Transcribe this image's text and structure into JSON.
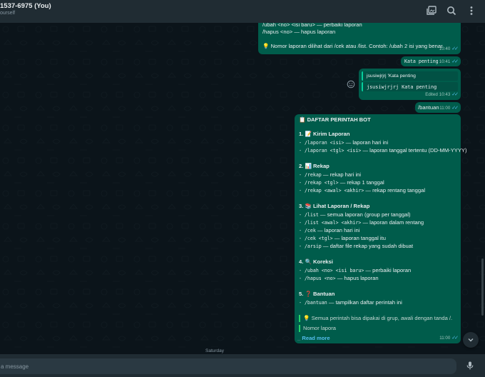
{
  "header": {
    "title": "1537-6975 (You)",
    "subtitle": "ourself",
    "icons": [
      "gallery-icon",
      "search-icon",
      "menu-icon"
    ]
  },
  "messages": {
    "m1": {
      "lines": [
        "/ubah <no> <isi baru> — perbaiki laporan",
        "/hapus <no> — hapus laporan",
        "",
        "💡 Nomor laporan dilihat dari /cek atau /list. Contoh: /ubah 2 isi yang benar"
      ],
      "time": "10:40"
    },
    "m2": {
      "text": "Kata penting",
      "time": "10:41"
    },
    "m3": {
      "quote1": "jsusiwjrjrj 'Kata penting",
      "quote2": "jsusiwjrjrj Kata penting",
      "edited": "Edited",
      "time": "10:43"
    },
    "m4": {
      "text": "/bantuan",
      "time": "11:00"
    },
    "m5": {
      "title": "📋 DAFTAR PERINTAH BOT",
      "s1_head": "1. 📝 Kirim Laporan",
      "s1_l1_cmd": "- /laporan <isi>",
      "s1_l1_desc": " — laporan hari ini",
      "s1_l2_cmd": "- /laporan <tgl> <isi>",
      "s1_l2_desc": " — laporan tanggal tertentu (DD-MM-YYYY)",
      "s2_head": "2. 📊 Rekap",
      "s2_l1_cmd": "- /rekap",
      "s2_l1_desc": " — rekap hari ini",
      "s2_l2_cmd": "- /rekap <tgl>",
      "s2_l2_desc": " — rekap 1 tanggal",
      "s2_l3_cmd": "- /rekap <awal> <akhir>",
      "s2_l3_desc": " — rekap rentang tanggal",
      "s3_head": "3. 📚 Lihat Laporan / Rekap",
      "s3_l1_cmd": "- /list",
      "s3_l1_desc": " — semua laporan (group per tanggal)",
      "s3_l2_cmd": "- /list <awal> <akhir>",
      "s3_l2_desc": " — laporan dalam rentang",
      "s3_l3_cmd": "- /cek",
      "s3_l3_desc": " — laporan hari ini",
      "s3_l4_cmd": "- /cek <tgl>",
      "s3_l4_desc": " — laporan tanggal itu",
      "s3_l5_cmd": "- /arsip",
      "s3_l5_desc": " — daftar file rekap yang sudah dibuat",
      "s4_head": "4. 🔍 Koreksi",
      "s4_l1_cmd": "- /ubah <no> <isi baru>",
      "s4_l1_desc": " — perbaiki laporan",
      "s4_l2_cmd": "- /hapus <no>",
      "s4_l2_desc": " — hapus laporan",
      "s5_head": "5. ❓ Bantuan",
      "s5_l1_cmd": "- /bantuan",
      "s5_l1_desc": " — tampilkan daftar perintah ini",
      "note1": "💡 Semua perintah bisa dipakai di grup, awali dengan tanda /.",
      "note2": "Nomor lapora",
      "read_more": "Read more",
      "time": "11:00"
    }
  },
  "date_chip": "Saturday",
  "composer": {
    "placeholder": "a message"
  }
}
